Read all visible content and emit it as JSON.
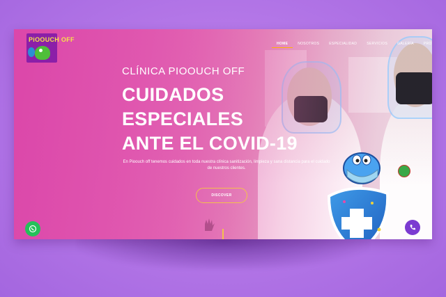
{
  "logo": {
    "text": "PiOOUCH OFF"
  },
  "nav": {
    "items": [
      {
        "label": "HOME",
        "active": true
      },
      {
        "label": "NOSOTROS",
        "active": false
      },
      {
        "label": "ESPECIALIDAD",
        "active": false
      },
      {
        "label": "SERVICIOS",
        "active": false
      },
      {
        "label": "GALERÍA",
        "active": false
      },
      {
        "label": "PROMOCIONES",
        "active": false
      }
    ]
  },
  "hero": {
    "kicker": "CLÍNICA PIOOUCH OFF",
    "headline_lines": [
      "CUIDADOS",
      "ESPECIALES",
      "ANTE EL COVID-19"
    ],
    "intro": "En Pioouch off tenemos cuidados en toda nuestra clínica sanitización, limpieza y sana distancia para el cuidado de nuestros clientes.",
    "cta_label": "DISCOVER"
  },
  "floating": {
    "whatsapp_icon": "whatsapp-icon",
    "phone_icon": "phone-icon"
  },
  "colors": {
    "page_bg": "#b578e8",
    "hero_pink": "#d94aa8",
    "accent": "#f4c14a",
    "whatsapp": "#25c05a",
    "phone": "#7b3bd1"
  }
}
